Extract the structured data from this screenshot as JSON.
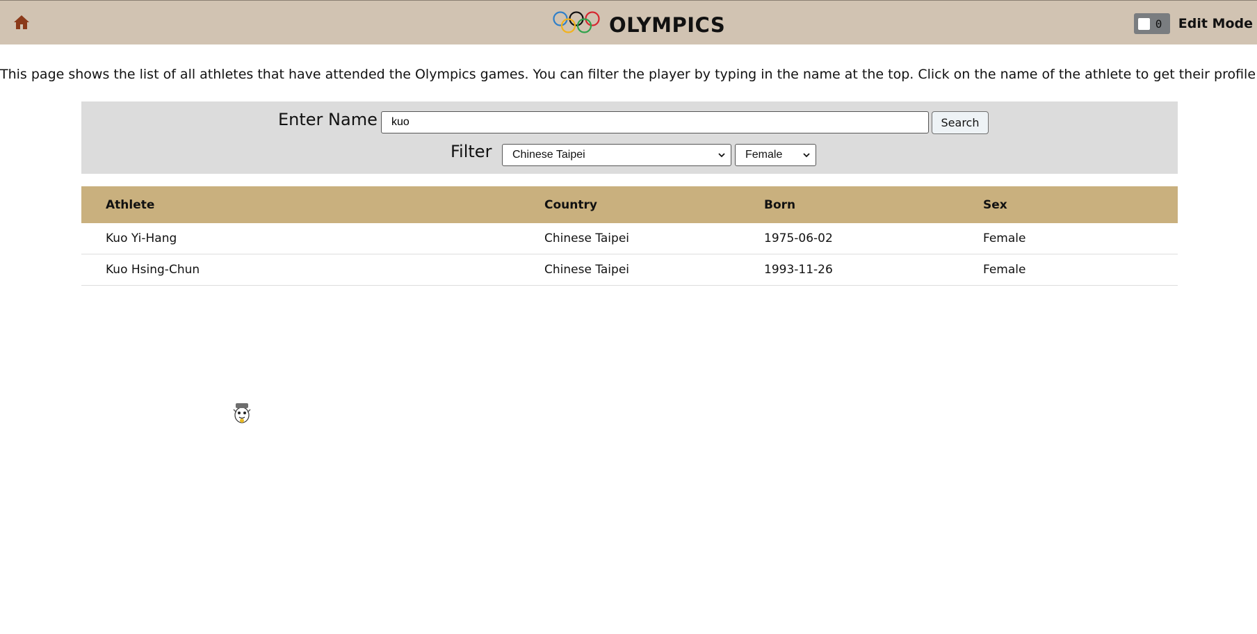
{
  "header": {
    "title": "OLYMPICS",
    "home_icon": "home-icon",
    "logo_icon": "olympic-rings-icon",
    "edit_mode": {
      "toggle_value": "0",
      "label": "Edit Mode",
      "checked": false
    }
  },
  "intro_text": "This page shows the list of all athletes that have attended the Olympics games. You can filter the player by typing in the name at the top. Click on the name of the athlete to get their profile.",
  "search": {
    "label": "Enter Name",
    "value": "kuo",
    "button_label": "Search"
  },
  "filter": {
    "label": "Filter",
    "country_selected": "Chinese Taipei",
    "sex_selected": "Female"
  },
  "table": {
    "columns": [
      "Athlete",
      "Country",
      "Born",
      "Sex"
    ],
    "rows": [
      {
        "athlete": "Kuo Yi-Hang",
        "country": "Chinese Taipei",
        "born": "1975-06-02",
        "sex": "Female"
      },
      {
        "athlete": "Kuo Hsing-Chun",
        "country": "Chinese Taipei",
        "born": "1993-11-26",
        "sex": "Female"
      }
    ]
  },
  "colors": {
    "header_bg": "#d1c3b2",
    "table_header_bg": "#c9b07e",
    "filter_panel_bg": "#dcdcdc",
    "home_icon": "#8b3a1a"
  }
}
